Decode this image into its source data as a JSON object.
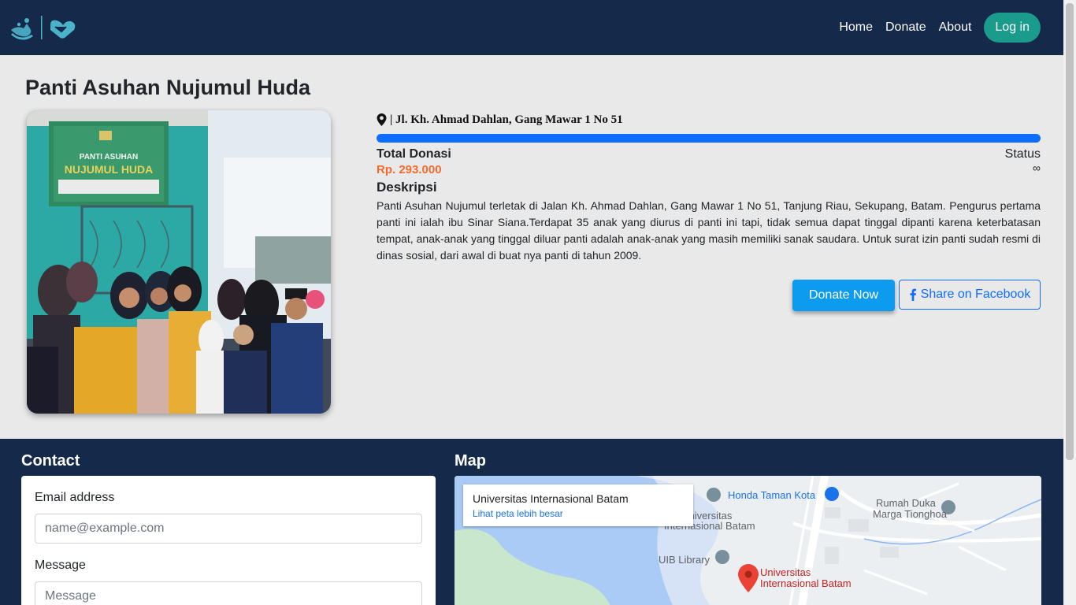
{
  "nav": {
    "links": [
      "Home",
      "Donate",
      "About"
    ],
    "login_label": "Log in"
  },
  "orphanage": {
    "title": "Panti Asuhan Nujumul Huda",
    "address": "| Jl. Kh. Ahmad Dahlan, Gang Mawar 1 No 51",
    "total_label": "Total Donasi",
    "total_value": "Rp. 293.000",
    "status_label": "Status",
    "status_value": "∞",
    "description_title": "Deskripsi",
    "description": "Panti Asuhan Nujumul terletak di Jalan Kh. Ahmad Dahlan, Gang Mawar 1 No 51, Tanjung Riau, Sekupang, Batam. Pengurus pertama panti ini ialah ibu Sinar Siana.Terdapat 35 anak yang diurus di panti ini tapi, tidak semua dapat tinggal dipanti karena keterbatasan tempat, anak-anak yang tinggal diluar panti adalah anak-anak yang masih memiliki sanak saudara. Untuk surat izin panti sudah resmi di dinas sosial, dari awal di buat nya panti di tahun 2009.",
    "donate_label": "Donate Now",
    "share_label": "Share on Facebook",
    "progress": 1.0,
    "photo_sign": {
      "line1": "PANTI ASUHAN",
      "line2": "NUJUMUL HUDA"
    }
  },
  "contact": {
    "title": "Contact",
    "email_label": "Email address",
    "email_placeholder": "name@example.com",
    "message_label": "Message",
    "message_placeholder": "Message"
  },
  "map": {
    "title": "Map",
    "card_title": "Universitas Internasional Batam",
    "card_link": "Lihat peta lebih besar",
    "places": {
      "honda": "Honda Taman Kota",
      "rumah_duka_1": "Rumah Duka",
      "rumah_duka_2": "Marga Tionghoa",
      "uib_faded_1": "na Universitas",
      "uib_faded_2": "Internasional Batam",
      "uib_library": "UIB Library",
      "pin_1": "Universitas",
      "pin_2": "Internasional Batam"
    }
  },
  "colors": {
    "navbar": "#15294a",
    "accent_teal": "#1a9b8c",
    "primary": "#0d6efd",
    "donate": "#0d9bf0",
    "amount": "#f06b2e"
  }
}
